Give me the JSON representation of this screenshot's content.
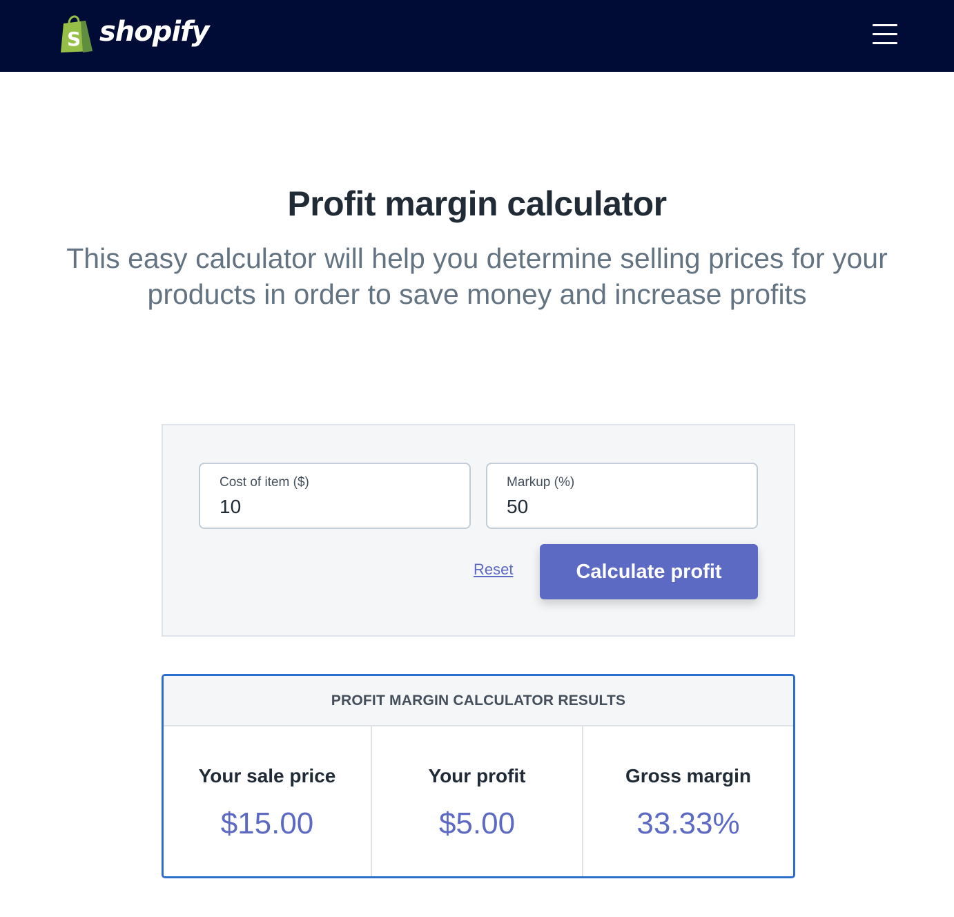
{
  "header": {
    "logo_text": "shopify",
    "logo_icon": "shopify-bag-icon",
    "menu_icon": "hamburger-menu-icon",
    "background_color": "#000c36"
  },
  "page": {
    "title": "Profit margin calculator",
    "subtitle": "This easy calculator will help you determine selling prices for your products in order to save money and increase profits"
  },
  "calculator": {
    "cost_label": "Cost of item ($)",
    "cost_value": "10",
    "markup_label": "Markup (%)",
    "markup_value": "50",
    "reset_label": "Reset",
    "calculate_label": "Calculate profit",
    "accent_color": "#5c6ac4"
  },
  "results": {
    "header": "PROFIT MARGIN CALCULATOR RESULTS",
    "sale_price_label": "Your sale price",
    "sale_price_value": "$15.00",
    "profit_label": "Your profit",
    "profit_value": "$5.00",
    "margin_label": "Gross margin",
    "margin_value": "33.33%",
    "border_color": "#2c6ecb"
  }
}
